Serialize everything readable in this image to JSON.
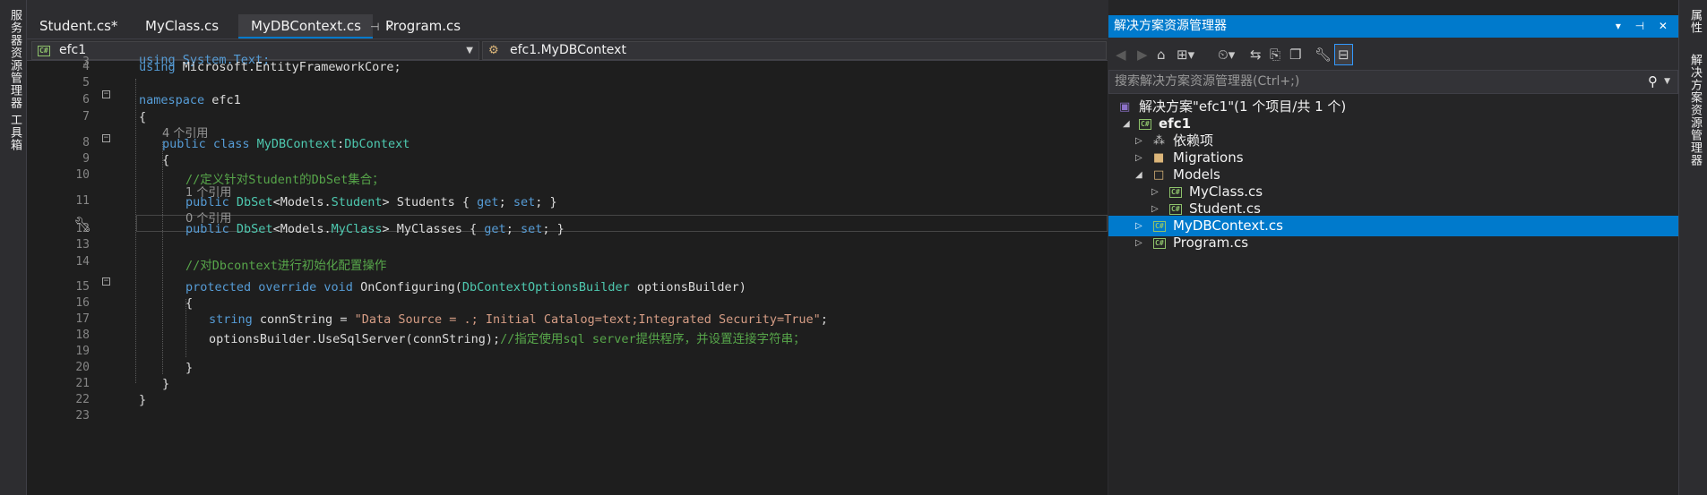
{
  "left_strip": {
    "server_explorer": "服务器资源管理器",
    "toolbox": "工具箱"
  },
  "right_strip": {
    "properties": "属性",
    "solution_explorer": "解决方案资源管理器"
  },
  "tabs": [
    {
      "label": "Student.cs*",
      "active": false
    },
    {
      "label": "MyClass.cs",
      "active": false
    },
    {
      "label": "MyDBContext.cs",
      "active": true,
      "pin": "⊣",
      "close": "×"
    },
    {
      "label": "Program.cs",
      "active": false
    }
  ],
  "navbar": {
    "project": "efc1",
    "member": "efc1.MyDBContext"
  },
  "code_lines": [
    {
      "num": "3"
    },
    {
      "num": "4"
    },
    {
      "num": "5"
    },
    {
      "num": "6"
    },
    {
      "num": "7"
    },
    {
      "num": ""
    },
    {
      "num": "8"
    },
    {
      "num": "9"
    },
    {
      "num": "10"
    },
    {
      "num": ""
    },
    {
      "num": "11"
    },
    {
      "num": ""
    },
    {
      "num": "12"
    },
    {
      "num": "13"
    },
    {
      "num": "14"
    },
    {
      "num": "15"
    },
    {
      "num": "16"
    },
    {
      "num": "17"
    },
    {
      "num": "18"
    },
    {
      "num": "19"
    },
    {
      "num": "20"
    },
    {
      "num": "21"
    },
    {
      "num": "22"
    },
    {
      "num": "23"
    }
  ],
  "code": {
    "l3": "using System.Text;",
    "l4_kw": "using",
    "l4_rest": " Microsoft.EntityFrameworkCore;",
    "l6_kw": "namespace",
    "l6_rest": " efc1",
    "l7": "{",
    "ref_a": "4 个引用",
    "l8_kw": "public class",
    "l8_name": " MyDBContext",
    "l8_colon": ":",
    "l8_base": "DbContext",
    "l9": "{",
    "l10_comment": "//定义针对Student的DbSet集合；",
    "ref_b": "1 个引用",
    "l11_kw": "public",
    "l11_type": " DbSet",
    "l11_lt": "<Models.",
    "l11_arg": "Student",
    "l11_rest": "> Students { ",
    "l11_get": "get",
    "l11_semi": "; ",
    "l11_set": "set",
    "l11_end": "; }",
    "ref_c": "0 个引用",
    "l12_kw": "public",
    "l12_type": " DbSet",
    "l12_lt": "<Models.",
    "l12_arg": "MyClass",
    "l12_rest": "> MyClasses { ",
    "l12_get": "get",
    "l12_semi": "; ",
    "l12_set": "set",
    "l12_end": "; }",
    "l14_comment": "//对Dbcontext进行初始化配置操作",
    "l15_kw": "protected override void",
    "l15_name": " OnConfiguring(",
    "l15_type": "DbContextOptionsBuilder",
    "l15_rest": " optionsBuilder)",
    "l16": "{",
    "l17_kw": "string",
    "l17_rest": " connString = ",
    "l17_str": "\"Data Source = .; Initial Catalog=text;Integrated Security=True\"",
    "l17_end": ";",
    "l18_code": "optionsBuilder.UseSqlServer(connString);",
    "l18_comment": "//指定使用sql server提供程序，并设置连接字符串；",
    "l20": "}",
    "l21": "}",
    "l22": "}"
  },
  "solution_explorer": {
    "title": "解决方案资源管理器",
    "title_buttons": "▾ ⊣ ✕",
    "search_placeholder": "搜索解决方案资源管理器(Ctrl+;)",
    "tree": [
      {
        "label": "解决方案\"efc1\"(1 个项目/共 1 个)",
        "icon": "solution-icon"
      },
      {
        "label": "efc1",
        "icon": "csharp-project-icon",
        "bold": true
      },
      {
        "label": "依赖项",
        "icon": "dependencies-icon"
      },
      {
        "label": "Migrations",
        "icon": "folder-icon"
      },
      {
        "label": "Models",
        "icon": "folder-open-icon"
      },
      {
        "label": "MyClass.cs",
        "icon": "csharp-file-icon"
      },
      {
        "label": "Student.cs",
        "icon": "csharp-file-icon"
      },
      {
        "label": "MyDBContext.cs",
        "icon": "csharp-file-icon",
        "selected": true
      },
      {
        "label": "Program.cs",
        "icon": "csharp-file-icon"
      }
    ]
  },
  "colors": {
    "accent": "#007acc",
    "keyword": "#569cd6",
    "type": "#4ec9b0",
    "comment": "#57a64a",
    "string": "#d69d85"
  }
}
